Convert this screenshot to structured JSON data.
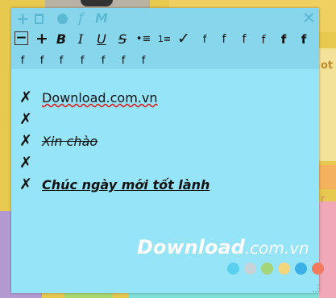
{
  "note": {
    "background": "#96e4f8",
    "titlebar": {
      "add_label": "+",
      "font_label": "f",
      "m_label": "M",
      "close_label": "✕",
      "icons": [
        "add-icon",
        "trash-icon",
        "color-icon",
        "font-icon",
        "markdown-icon",
        "close-icon"
      ]
    },
    "toolbar": {
      "row1": [
        "−",
        "+",
        "B",
        "I",
        "U",
        "S",
        "•≡",
        "1≡",
        "✓",
        "f",
        "f",
        "f",
        "f",
        "f",
        "f"
      ],
      "row2": [
        "f",
        "f",
        "f",
        "f",
        "f",
        "f",
        "f"
      ]
    },
    "items": [
      {
        "check": "✗",
        "text": "Download.com.vn"
      },
      {
        "check": "✗",
        "text": ""
      },
      {
        "check": "✗",
        "text": "Xin chào"
      },
      {
        "check": "✗",
        "text": ""
      },
      {
        "check": "✗",
        "text": "Chúc ngày mới tốt lành"
      }
    ],
    "watermark": {
      "main": "Download",
      "sub": ".com.vn"
    },
    "palette": [
      "#5ad0ef",
      "#c8d3d8",
      "#a5d57a",
      "#f5d57a",
      "#3bb0e6",
      "#f47a5e"
    ]
  },
  "background": {
    "right_text_1": "ot",
    "right_text_2": "r"
  }
}
